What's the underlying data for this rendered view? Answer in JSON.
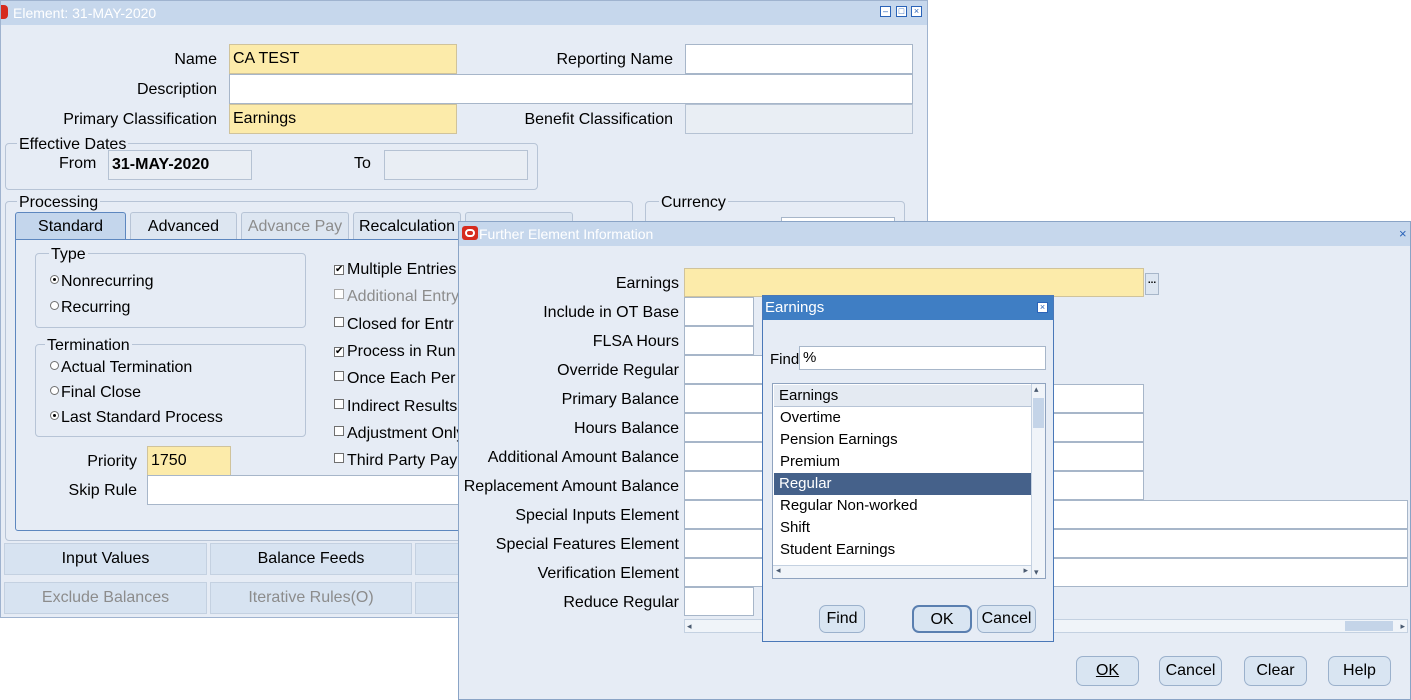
{
  "element_window": {
    "title": "Element: 31-MAY-2020",
    "name_label": "Name",
    "name_value": "CA TEST",
    "reporting_name_label": "Reporting Name",
    "reporting_name_value": "",
    "description_label": "Description",
    "description_value": "",
    "primary_classification_label": "Primary Classification",
    "primary_classification_value": "Earnings",
    "benefit_classification_label": "Benefit Classification",
    "benefit_classification_value": "",
    "effective_dates": {
      "title": "Effective Dates",
      "from_label": "From",
      "from_value": "31-MAY-2020",
      "to_label": "To",
      "to_value": ""
    },
    "processing_title": "Processing",
    "currency_title": "Currency",
    "tabs": [
      "Standard",
      "Advanced",
      "Advance Pay",
      "Recalculation"
    ],
    "type": {
      "title": "Type",
      "options": [
        "Nonrecurring",
        "Recurring"
      ],
      "selected": "Nonrecurring"
    },
    "termination": {
      "title": "Termination",
      "options": [
        "Actual Termination",
        "Final Close",
        "Last Standard Process"
      ],
      "selected": "Last Standard Process"
    },
    "checkboxes": [
      {
        "label": "Multiple Entries",
        "checked": true,
        "enabled": true
      },
      {
        "label": "Additional Entry",
        "checked": false,
        "enabled": false
      },
      {
        "label": "Closed for Entr",
        "checked": false,
        "enabled": true
      },
      {
        "label": "Process in Run",
        "checked": true,
        "enabled": true
      },
      {
        "label": "Once Each Per",
        "checked": false,
        "enabled": true
      },
      {
        "label": "Indirect Results",
        "checked": false,
        "enabled": true
      },
      {
        "label": "Adjustment Only",
        "checked": false,
        "enabled": true
      },
      {
        "label": "Third Party Pay",
        "checked": false,
        "enabled": true
      }
    ],
    "priority_label": "Priority",
    "priority_value": "1750",
    "skip_rule_label": "Skip Rule",
    "skip_rule_value": "",
    "buttons": {
      "input_values": "Input Values",
      "balance_feeds": "Balance Feeds",
      "exclude_balances": "Exclude Balances",
      "iterative_rules": "Iterative Rules(O)"
    }
  },
  "further_window": {
    "title": "Further Element Information",
    "fields": [
      {
        "label": "Earnings",
        "value": ""
      },
      {
        "label": "Include in OT Base",
        "value": ""
      },
      {
        "label": "FLSA Hours",
        "value": ""
      },
      {
        "label": "Override Regular",
        "value": ""
      },
      {
        "label": "Primary Balance",
        "value": ""
      },
      {
        "label": "Hours Balance",
        "value": ""
      },
      {
        "label": "Additional Amount Balance",
        "value": ""
      },
      {
        "label": "Replacement Amount Balance",
        "value": ""
      },
      {
        "label": "Special Inputs Element",
        "value": ""
      },
      {
        "label": "Special Features Element",
        "value": ""
      },
      {
        "label": "Verification Element",
        "value": ""
      },
      {
        "label": "Reduce Regular",
        "value": ""
      }
    ],
    "lov_button": "...",
    "buttons": {
      "ok": "OK",
      "cancel": "Cancel",
      "clear": "Clear",
      "help": "Help"
    }
  },
  "lov_dialog": {
    "title": "Earnings",
    "find_label": "Find",
    "find_value": "%",
    "column_header": "Earnings",
    "items": [
      "Overtime",
      "Pension Earnings",
      "Premium",
      "Regular",
      "Regular Non-worked",
      "Shift",
      "Student Earnings"
    ],
    "selected": "Regular",
    "buttons": {
      "find": "Find",
      "ok": "OK",
      "cancel": "Cancel"
    }
  },
  "colors": {
    "window_bg": "#e6ecf5",
    "title_active": "#3f7ec4",
    "title_inactive": "#c6d7ec",
    "required_field": "#fcebaa",
    "selected_row": "#45618a"
  }
}
